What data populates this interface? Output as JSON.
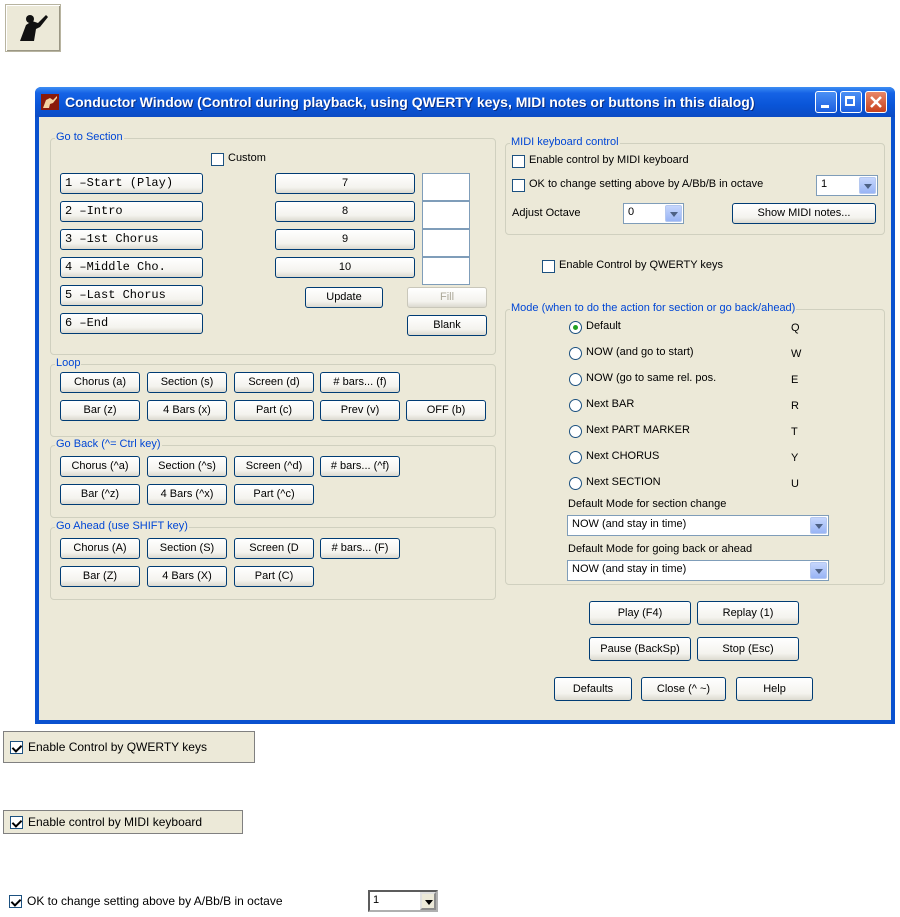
{
  "window": {
    "title": "Conductor Window (Control during playback, using QWERTY keys, MIDI notes or buttons in this dialog)",
    "colors": {
      "titlebar": "#0a55d8",
      "client": "#ece9d8",
      "legend": "#0046d5"
    }
  },
  "goto_section": {
    "legend": "Go to Section",
    "custom_label": "Custom",
    "custom_checked": false,
    "left_buttons": [
      "1 –Start (Play)",
      "2 –Intro",
      "3 –1st Chorus",
      "4 –Middle Cho.",
      "5 –Last Chorus",
      "6 –End"
    ],
    "right_buttons": [
      "7",
      "8",
      "9",
      "10"
    ],
    "update_label": "Update",
    "fill_label": "Fill",
    "blank_label": "Blank"
  },
  "loop": {
    "legend": "Loop",
    "row1": [
      "Chorus (a)",
      "Section (s)",
      "Screen (d)",
      "# bars... (f)"
    ],
    "row2": [
      "Bar (z)",
      "4 Bars (x)",
      "Part (c)",
      "Prev (v)",
      "OFF (b)"
    ]
  },
  "go_back": {
    "legend": "Go Back  (^= Ctrl key)",
    "row1": [
      "Chorus (^a)",
      "Section (^s)",
      "Screen (^d)",
      "# bars... (^f)"
    ],
    "row2": [
      "Bar (^z)",
      "4 Bars (^x)",
      "Part (^c)"
    ]
  },
  "go_ahead": {
    "legend": "Go Ahead  (use SHIFT key)",
    "row1": [
      "Chorus (A)",
      "Section (S)",
      "Screen (D",
      "# bars... (F)"
    ],
    "row2": [
      "Bar (Z)",
      "4 Bars (X)",
      "Part (C)"
    ]
  },
  "midi": {
    "legend": "MIDI keyboard control",
    "enable_label": "Enable control by MIDI keyboard",
    "enable_checked": false,
    "ok_change_label": "OK to change setting above by  A/Bb/B in octave",
    "ok_change_checked": false,
    "octave_combo_value": "1",
    "adjust_label": "Adjust Octave",
    "adjust_value": "0",
    "show_notes_label": "Show MIDI notes..."
  },
  "qwerty": {
    "enable_label": "Enable Control by QWERTY keys",
    "checked": false
  },
  "mode": {
    "legend": "Mode (when to do the action for section or go back/ahead)",
    "options": [
      {
        "label": "Default",
        "key": "Q",
        "selected": true
      },
      {
        "label": "NOW (and go to start)",
        "key": "W",
        "selected": false
      },
      {
        "label": "NOW (go to same rel. pos.",
        "key": "E",
        "selected": false
      },
      {
        "label": "Next BAR",
        "key": "R",
        "selected": false
      },
      {
        "label": "Next PART MARKER",
        "key": "T",
        "selected": false
      },
      {
        "label": "Next CHORUS",
        "key": "Y",
        "selected": false
      },
      {
        "label": "Next SECTION",
        "key": "U",
        "selected": false
      }
    ],
    "section_change_label": "Default Mode for section change",
    "section_change_value": "NOW (and stay in time)",
    "back_ahead_label": "Default Mode for going back or ahead",
    "back_ahead_value": "NOW (and stay in time)"
  },
  "transport": {
    "play": "Play (F4)",
    "replay": "Replay (1)",
    "pause": "Pause (BackSp)",
    "stop": "Stop (Esc)",
    "defaults": "Defaults",
    "close": "Close (^ ~)",
    "help": "Help"
  },
  "snippets": {
    "qwerty_label": "Enable Control by QWERTY keys",
    "midi_label": "Enable control by MIDI keyboard",
    "ok_change_label": "OK to change setting above by  A/Bb/B in octave",
    "octave_value": "1"
  }
}
